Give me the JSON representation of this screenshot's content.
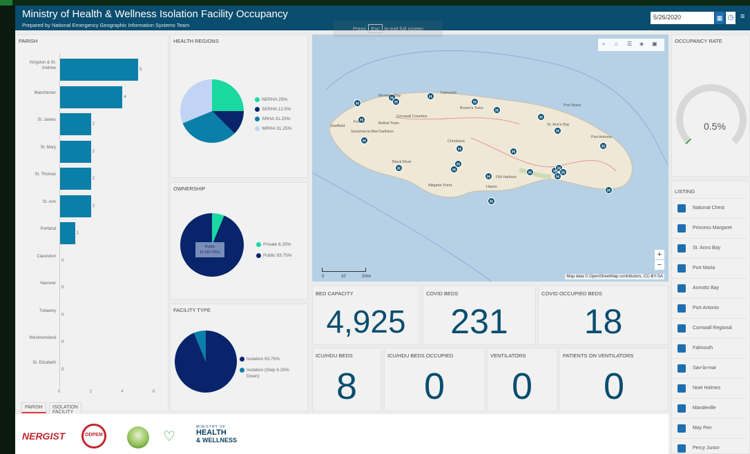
{
  "header": {
    "title": "Ministry of Health & Wellness Isolation Facility Occupancy",
    "subtitle": "Prepared by National Emergency Geographic Information Systems Team",
    "date": "5/26/2020"
  },
  "hint": {
    "pre": "Press",
    "key": "Esc",
    "post": "to exit full screen"
  },
  "parish": {
    "title": "PARISH",
    "xticks": [
      "0",
      "2",
      "4",
      "6"
    ],
    "tabs": [
      "PARISH",
      "ISOLATION FACILITY"
    ]
  },
  "chart_data": [
    {
      "type": "bar",
      "orientation": "horizontal",
      "title": "PARISH",
      "categories": [
        "Kingston & St. Andrew",
        "Manchester",
        "St. James",
        "St. Mary",
        "St. Thomas",
        "St. Ann",
        "Portland",
        "Clarendon",
        "Hanover",
        "Trelawny",
        "Westmoreland",
        "St. Elizabeth"
      ],
      "values": [
        5,
        4,
        2,
        2,
        2,
        2,
        1,
        0,
        0,
        0,
        0,
        0
      ],
      "xlim": [
        0,
        6
      ],
      "color": "#0b7fa8"
    },
    {
      "type": "pie",
      "title": "HEALTH REGIONS",
      "labels": [
        "NERHA",
        "SERHA",
        "SRHA",
        "WRHA"
      ],
      "values": [
        25,
        12.5,
        31.25,
        31.25
      ],
      "colors": [
        "#19d9a0",
        "#08246b",
        "#0b7fa8",
        "#c1d4f5"
      ]
    },
    {
      "type": "pie",
      "title": "OWNERSHIP",
      "labels": [
        "Private",
        "Public"
      ],
      "values": [
        6.25,
        93.75
      ],
      "colors": [
        "#19d9a0",
        "#08246b"
      ],
      "tooltip": "Public\n15 (93.75%)"
    },
    {
      "type": "pie",
      "title": "FACILITY TYPE",
      "labels": [
        "Isolation",
        "Isolation (Step Down)"
      ],
      "values": [
        93.75,
        6.25
      ],
      "colors": [
        "#08246b",
        "#0b7fa8"
      ]
    }
  ],
  "regions": {
    "title": "HEALTH REGIONS",
    "legend": [
      "NERHA  25%",
      "SERHA  12.5%",
      "SRHA  31.25%",
      "WRHA  31.25%"
    ]
  },
  "ownership": {
    "title": "OWNERSHIP",
    "legend": [
      "Private  6.25%",
      "Public  93.75%"
    ],
    "tooltip_line1": "Public",
    "tooltip_line2": "15 (93.75%)"
  },
  "facility": {
    "title": "FACILITY TYPE",
    "legend_1": "Isolation  93.75%",
    "legend_2a": "Isolation (Step  6.25%",
    "legend_2b": "Down)"
  },
  "map": {
    "attribution": "Map data © OpenStreetMap contributors, CC-BY-SA",
    "scale_0": "0",
    "scale_10": "10",
    "scale_20": "20mi",
    "zoom_in": "+",
    "zoom_out": "−",
    "places": [
      "Montego Bay",
      "Falmouth",
      "Brown's Town",
      "St. Ann's Bay",
      "Port Maria",
      "Port Antonio",
      "Sheffield",
      "Frome",
      "Savanna-la-Mar",
      "Darliston",
      "Bethel Town",
      "Christiana",
      "Black River",
      "Old Harbour",
      "Alligator Pond",
      "Hayes",
      "Cornwall Counties"
    ]
  },
  "kpis": {
    "bed_capacity": {
      "title": "BED CAPACITY",
      "value": "4,925"
    },
    "covid_beds": {
      "title": "COVID BEDS",
      "value": "231"
    },
    "covid_occupied": {
      "title": "COVID OCCUPIED BEDS",
      "value": "18"
    },
    "icu_beds": {
      "title": "ICU/HDU BEDS",
      "value": "8"
    },
    "icu_occupied": {
      "title": "ICU/HDU BEDS OCCUPIED",
      "value": "0"
    },
    "ventilators": {
      "title": "VENTILATORS",
      "value": "0"
    },
    "patients_vent": {
      "title": "PATIENTS ON VENTILATORS",
      "value": "0"
    }
  },
  "occupancy": {
    "title": "OCCUPANCY RATE",
    "value": "0.5%",
    "fraction": 0.005
  },
  "listing": {
    "title": "LISTING",
    "items": [
      "National Chest",
      "Princess Margaret",
      "St. Anns Bay",
      "Port Maria",
      "Annotto Bay",
      "Port Antonio",
      "Cornwall Regional",
      "Falmouth",
      "Sav-la-mar",
      "Noel Holmes",
      "Mandeville",
      "May Pen",
      "Percy Junior"
    ]
  },
  "footer": {
    "logos": [
      "NERGIST",
      "ODPEM",
      "MINISTRY OF HEALTH & WELLNESS"
    ],
    "health_line1": "HEALTH",
    "health_line2": "& WELLNESS",
    "ministry_small": "MINISTRY OF"
  },
  "colors": {
    "header": "#0a4d6e",
    "bar": "#0b7fa8",
    "kpi": "#0a4d6e",
    "accent": "#e0373b"
  }
}
